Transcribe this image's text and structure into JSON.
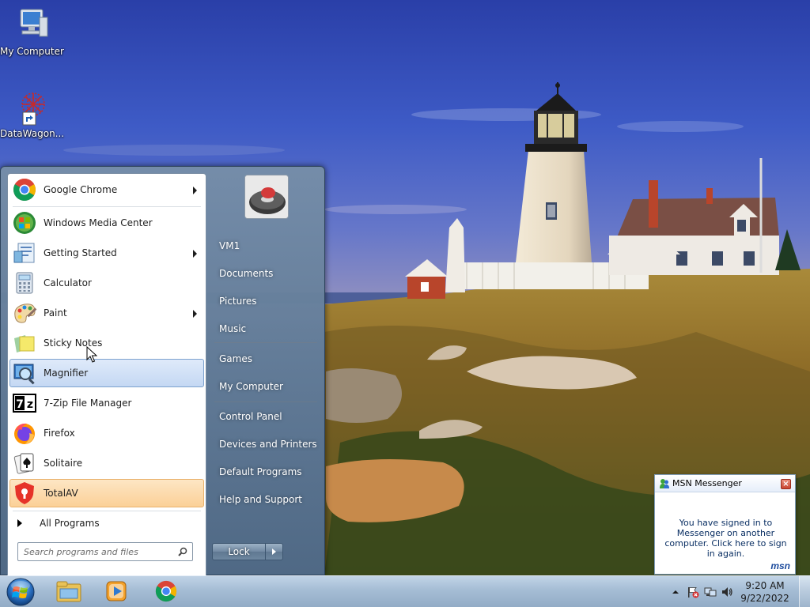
{
  "desktop": {
    "icons": [
      {
        "label": "My Computer",
        "icon": "computer-icon"
      },
      {
        "label": "DataWagon...",
        "icon": "datawagon-shortcut-icon"
      }
    ]
  },
  "start_menu": {
    "programs": [
      {
        "label": "Google Chrome",
        "icon": "chrome-icon",
        "submenu": true
      },
      {
        "label": "Windows Media Center",
        "icon": "media-center-icon",
        "submenu": false
      },
      {
        "label": "Getting Started",
        "icon": "getting-started-icon",
        "submenu": true
      },
      {
        "label": "Calculator",
        "icon": "calculator-icon",
        "submenu": false
      },
      {
        "label": "Paint",
        "icon": "paint-icon",
        "submenu": true
      },
      {
        "label": "Sticky Notes",
        "icon": "sticky-notes-icon",
        "submenu": false
      },
      {
        "label": "Magnifier",
        "icon": "magnifier-icon",
        "submenu": false,
        "state": "hover"
      },
      {
        "label": "7-Zip File Manager",
        "icon": "7zip-icon",
        "submenu": false
      },
      {
        "label": "Firefox",
        "icon": "firefox-icon",
        "submenu": false
      },
      {
        "label": "Solitaire",
        "icon": "solitaire-icon",
        "submenu": false
      },
      {
        "label": "TotalAV",
        "icon": "totalav-icon",
        "submenu": false,
        "state": "newly-installed"
      }
    ],
    "all_programs_label": "All Programs",
    "search_placeholder": "Search programs and files",
    "right_links": [
      {
        "label": "VM1"
      },
      {
        "label": "Documents"
      },
      {
        "label": "Pictures"
      },
      {
        "label": "Music"
      },
      {
        "label": "Games"
      },
      {
        "label": "My Computer"
      },
      {
        "label": "Control Panel"
      },
      {
        "label": "Devices and Printers"
      },
      {
        "label": "Default Programs"
      },
      {
        "label": "Help and Support"
      }
    ],
    "lock_label": "Lock"
  },
  "taskbar": {
    "pinned": [
      {
        "icon": "windows-explorer-icon"
      },
      {
        "icon": "media-player-icon"
      },
      {
        "icon": "chrome-icon"
      }
    ],
    "clock_time": "9:20 AM",
    "clock_date": "9/22/2022"
  },
  "notification": {
    "title": "MSN Messenger",
    "message": "You have signed in to Messenger on another computer. Click here to sign in again.",
    "logo": "msn"
  },
  "colors": {
    "highlight_hover": "#c4d8f3",
    "highlight_new": "#fbd097",
    "start_menu_frame": "#6c88a4"
  }
}
